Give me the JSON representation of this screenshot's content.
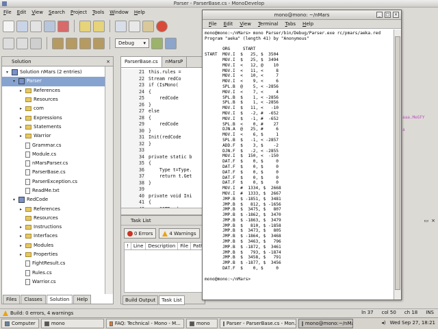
{
  "window": {
    "title": "Parser - ParserBase.cs - MonoDevelop"
  },
  "menubar": [
    "File",
    "Edit",
    "View",
    "Search",
    "Project",
    "Tools",
    "Window",
    "Help"
  ],
  "toolbar": {
    "config": "Debug"
  },
  "solution": {
    "title": "Solution",
    "items": [
      {
        "label": "Solution nMars (2 entries)",
        "kind": "solution",
        "depth": 0,
        "arrow": "▾"
      },
      {
        "label": "Parser",
        "kind": "project",
        "depth": 1,
        "arrow": "▾",
        "selected": true
      },
      {
        "label": "References",
        "kind": "folder",
        "depth": 2,
        "arrow": "▸"
      },
      {
        "label": "Resources",
        "kind": "folder",
        "depth": 2,
        "arrow": ""
      },
      {
        "label": "com",
        "kind": "folder",
        "depth": 2,
        "arrow": "▸"
      },
      {
        "label": "Expressions",
        "kind": "folder",
        "depth": 2,
        "arrow": "▸"
      },
      {
        "label": "Statements",
        "kind": "folder",
        "depth": 2,
        "arrow": "▸"
      },
      {
        "label": "Warrior",
        "kind": "folder",
        "depth": 2,
        "arrow": "▸"
      },
      {
        "label": "Grammar.cs",
        "kind": "file",
        "depth": 2,
        "arrow": ""
      },
      {
        "label": "Module.cs",
        "kind": "file",
        "depth": 2,
        "arrow": ""
      },
      {
        "label": "nMarsParser.cs",
        "kind": "file",
        "depth": 2,
        "arrow": ""
      },
      {
        "label": "ParserBase.cs",
        "kind": "file",
        "depth": 2,
        "arrow": ""
      },
      {
        "label": "ParserException.cs",
        "kind": "file",
        "depth": 2,
        "arrow": ""
      },
      {
        "label": "ReadMe.txt",
        "kind": "file",
        "depth": 2,
        "arrow": ""
      },
      {
        "label": "RedCode",
        "kind": "project",
        "depth": 1,
        "arrow": "▾"
      },
      {
        "label": "References",
        "kind": "folder",
        "depth": 2,
        "arrow": "▸"
      },
      {
        "label": "Resources",
        "kind": "folder",
        "depth": 2,
        "arrow": ""
      },
      {
        "label": "Instructions",
        "kind": "folder",
        "depth": 2,
        "arrow": "▸"
      },
      {
        "label": "Interfaces",
        "kind": "folder",
        "depth": 2,
        "arrow": "▸"
      },
      {
        "label": "Modules",
        "kind": "folder",
        "depth": 2,
        "arrow": "▸"
      },
      {
        "label": "Properties",
        "kind": "folder",
        "depth": 2,
        "arrow": "▸"
      },
      {
        "label": "FightResult.cs",
        "kind": "file",
        "depth": 2,
        "arrow": ""
      },
      {
        "label": "Rules.cs",
        "kind": "file",
        "depth": 2,
        "arrow": ""
      },
      {
        "label": "Warrior.cs",
        "kind": "file",
        "depth": 2,
        "arrow": ""
      }
    ],
    "tabs": [
      "Files",
      "Classes",
      "Solution",
      "Help"
    ],
    "active_tab": 2
  },
  "editor": {
    "tabs": [
      "ParserBase.cs",
      "nMarsP"
    ],
    "line_numbers": [
      "21",
      "22",
      "23",
      "24",
      "25",
      "26",
      "27",
      "28",
      "29",
      "30",
      "31",
      "32",
      "33",
      "34",
      "35",
      "36",
      "37",
      "38",
      "39",
      "40",
      "41",
      "42"
    ],
    "lines": [
      "this.rules =",
      "Stream redCo",
      "if (IsMono(",
      "{",
      "    redCode",
      "}",
      "else",
      "{",
      "    redCode",
      "}",
      "Init(redCode",
      "}",
      "",
      "private static b",
      "{",
      "    Type t=Type.",
      "    return t.Get",
      "}",
      "",
      "private void Ini",
      "{",
      "    CGTReader re",
      "    parser = rea"
    ]
  },
  "tasklist": {
    "title": "Task List",
    "errors": "0 Errors",
    "warnings": "4 Warnings",
    "columns": [
      "!",
      "Line",
      "Description",
      "File",
      "Path"
    ],
    "tabs": [
      "Build Output",
      "Task List"
    ]
  },
  "status": {
    "message": "Build: 0 errors, 4 warnings",
    "ln": "ln 37",
    "col": "col 50",
    "ch": "ch 18",
    "mode": "INS"
  },
  "taskbar": {
    "items": [
      "Computer",
      "mono",
      "FAQ: Technical - Mono - M...",
      "mono",
      "Parser - ParserBase.cs - Mon...",
      "mono@mono:~/nMars"
    ],
    "clock": "Wed Sep 27, 18:21"
  },
  "terminal": {
    "title": "mono@mono: ~/nMars",
    "menu": [
      "File",
      "Edit",
      "View",
      "Terminal",
      "Tabs",
      "Help"
    ],
    "lines": [
      "mono@mono:~/nMars> mono Parser/bin/Debug/Parser.exe rc/pmars/aeka.red",
      "Program \"aeka\" (length 41) by \"Anonymous\"",
      "",
      "       ORG     START",
      "START  MOV.I  $   25, $  3504",
      "       MOV.I  $   25, $  3494",
      "       MOV.I  <   12, @    10",
      "       MOV.I  <   11, <     8",
      "       MOV.I  <   10, <     7",
      "       MOV.I  <    9, <     6",
      "       SPL.B  @    5, < -2856",
      "       MOV.I  <    7, <     4",
      "       SPL.B  $    1, < -2856",
      "       SPL.B  $    1, < -2856",
      "       MOV.I  $   11, <   -10",
      "       MOV.I  $   -2, #  -652",
      "       MOV.I  $   -1, #  -652",
      "       SPL.B  <    0, #    27",
      "       DJN.A  @   25, #     6",
      "       MOV.I  <    6, $     1",
      "       SPL.B  $   -1, < -2857",
      "       ADD.F  $    3, $    -2",
      "       DJN.F  $   -2, < -2855",
      "       MOV.I  $  150, <  -150",
      "       DAT.F  $    0, $     0",
      "       DAT.F  $    0, $     0",
      "       DAT.F  $    0, $     0",
      "       DAT.F  $    0, $     0",
      "       DAT.F  $    0, $     0",
      "       MOV.I  #  1334, $  2668",
      "       MOV.I  #  1333, $  2667",
      "       JMP.B  $ -1851, $  3481",
      "       JMP.B  $   812, $ -1656",
      "       JMP.B  $  3475, $   807",
      "       JMP.B  $ -1862, $  3470",
      "       JMP.B  $ -1863, $  3479",
      "       JMP.B  $   810, $ -1858",
      "       JMP.B  $  3473, $   805",
      "       JMP.B  $ -1864, $  3468",
      "       JMP.B  $  3463, $   796",
      "       JMP.B  $ -1872, $  3461",
      "       JMP.B  $   793, $ -1874",
      "       JMP.B  $  3458, $   791",
      "       JMP.B  $ -1877, $  3456",
      "       DAT.F  $    0, $     0",
      "",
      "mono@mono:~/nMars>"
    ]
  },
  "background": {
    "fragment1": "aaa.MeGFY",
    "fragment2": "a"
  },
  "colors": {
    "selection": "#86a3d0",
    "error": "#cc3322",
    "warning": "#e8a317",
    "folder": "#e7c865"
  }
}
